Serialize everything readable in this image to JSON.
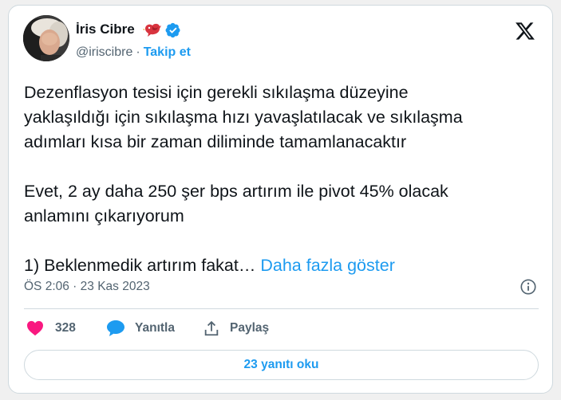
{
  "author": {
    "name": "İris Cibre",
    "handle": "@iriscibre",
    "separator": "·",
    "follow_label": "Takip et"
  },
  "tweet": {
    "paragraph1": [
      "Dezenflasyon tesisi için gerekli sıkılaşma düzeyine",
      "yaklaşıldığı için sıkılaşma hızı yavaşlatılacak ve sıkılaşma",
      "adımları kısa bir zaman diliminde tamamlanacaktır"
    ],
    "paragraph2": [
      "Evet, 2 ay daha 250 şer bps artırım ile pivot 45% olacak",
      "anlamını çıkarıyorum"
    ],
    "truncated_line": "1) Beklenmedik artırım fakat…",
    "show_more_label": "Daha fazla göster",
    "timestamp": "ÖS 2:06 · 23 Kas 2023"
  },
  "actions": {
    "like_count": "328",
    "reply_label": "Yanıtla",
    "share_label": "Paylaş"
  },
  "read_replies_label": "23 yanıtı oku",
  "colors": {
    "accent": "#1d9bf0",
    "like": "#f91880",
    "text": "#0f1419",
    "secondary_text": "#536471",
    "border": "#cfd9de"
  },
  "icons": {
    "bird": "red-bird-icon",
    "verified": "verified-badge-icon",
    "logo": "x-logo-icon",
    "info": "info-icon",
    "like": "heart-icon",
    "reply": "speech-bubble-icon",
    "share": "share-upload-icon"
  }
}
